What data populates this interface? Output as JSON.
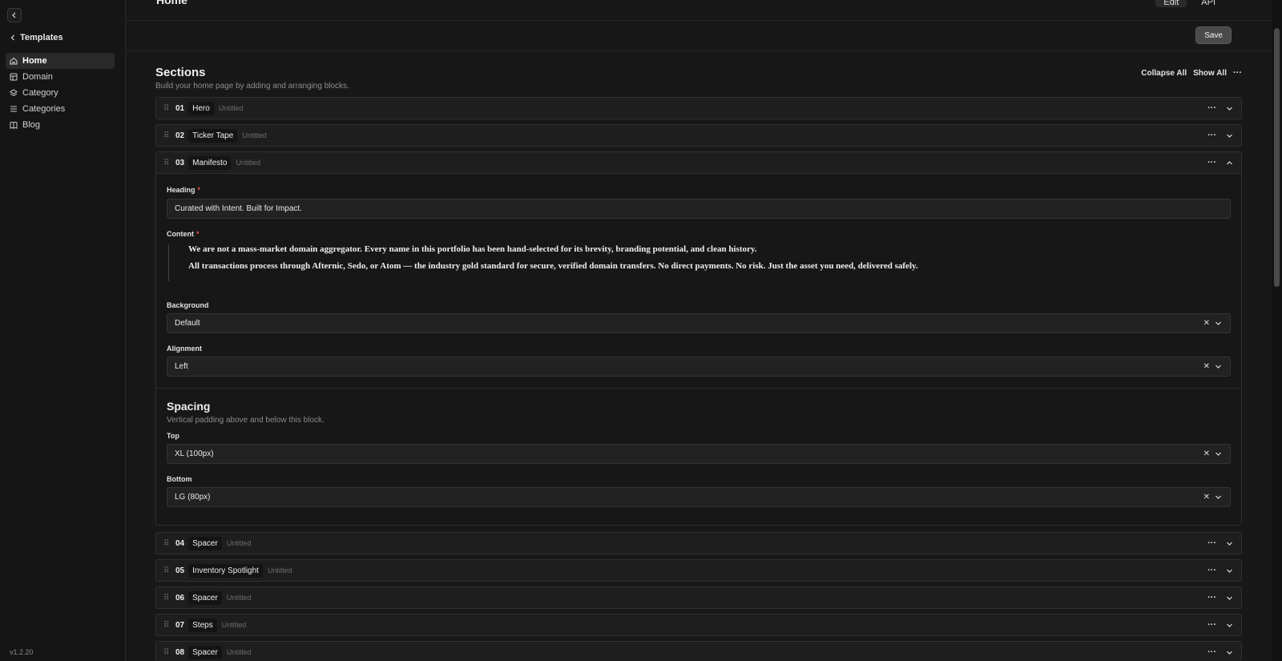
{
  "sidebar": {
    "back_label": "Templates",
    "items": [
      {
        "label": "Home",
        "icon": "home-icon",
        "active": true
      },
      {
        "label": "Domain",
        "icon": "table-icon",
        "active": false
      },
      {
        "label": "Category",
        "icon": "layers-icon",
        "active": false
      },
      {
        "label": "Categories",
        "icon": "list-icon",
        "active": false
      },
      {
        "label": "Blog",
        "icon": "book-icon",
        "active": false
      }
    ],
    "version": "v1.2.20"
  },
  "header": {
    "title": "Home",
    "tabs": [
      "Edit",
      "API"
    ],
    "save_label": "Save"
  },
  "sections": {
    "title": "Sections",
    "subtitle": "Build your home page by adding and arranging blocks.",
    "collapse_all": "Collapse All",
    "show_all": "Show All",
    "blocks": [
      {
        "num": "01",
        "type": "Hero",
        "status": "Untitled"
      },
      {
        "num": "02",
        "type": "Ticker Tape",
        "status": "Untitled"
      },
      {
        "num": "03",
        "type": "Manifesto",
        "status": "Untitled"
      },
      {
        "num": "04",
        "type": "Spacer",
        "status": "Untitled"
      },
      {
        "num": "05",
        "type": "Inventory Spotlight",
        "status": "Untitled"
      },
      {
        "num": "06",
        "type": "Spacer",
        "status": "Untitled"
      },
      {
        "num": "07",
        "type": "Steps",
        "status": "Untitled"
      },
      {
        "num": "08",
        "type": "Spacer",
        "status": "Untitled"
      }
    ]
  },
  "manifesto": {
    "heading_label": "Heading",
    "heading_value": "Curated with Intent. Built for Impact.",
    "content_label": "Content",
    "content_p1": "We are not a mass-market domain aggregator. Every name in this portfolio has been hand-selected for its brevity, branding potential, and clean history.",
    "content_p2": "All transactions process through Afternic, Sedo, or Atom — the industry gold standard for secure, verified domain transfers. No direct payments. No risk. Just the asset you need, delivered safely.",
    "background_label": "Background",
    "background_value": "Default",
    "alignment_label": "Alignment",
    "alignment_value": "Left",
    "spacing_title": "Spacing",
    "spacing_sub": "Vertical padding above and below this block.",
    "top_label": "Top",
    "top_value": "XL (100px)",
    "bottom_label": "Bottom",
    "bottom_value": "LG (80px)"
  }
}
